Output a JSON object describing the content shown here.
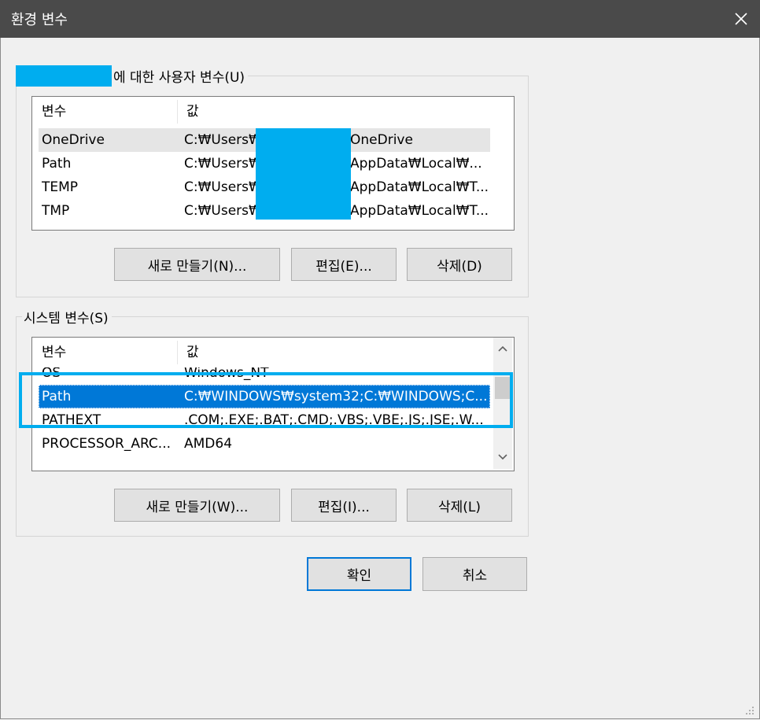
{
  "window": {
    "title": "환경 변수",
    "close_icon": "close-icon"
  },
  "user_vars": {
    "legend": "에 대한 사용자 변수(U)",
    "columns": [
      "변수",
      "값"
    ],
    "rows": [
      {
        "name": "OneDrive",
        "value_prefix": "C:₩Users₩",
        "value_suffix": "OneDrive"
      },
      {
        "name": "Path",
        "value_prefix": "C:₩Users₩",
        "value_suffix": "AppData₩Local₩..."
      },
      {
        "name": "TEMP",
        "value_prefix": "C:₩Users₩",
        "value_suffix": "AppData₩Local₩T..."
      },
      {
        "name": "TMP",
        "value_prefix": "C:₩Users₩",
        "value_suffix": "AppData₩Local₩T..."
      }
    ],
    "buttons": {
      "new": "새로 만들기(N)...",
      "edit": "편집(E)...",
      "delete": "삭제(D)"
    }
  },
  "system_vars": {
    "legend": "시스템 변수(S)",
    "columns": [
      "변수",
      "값"
    ],
    "rows": [
      {
        "name": "OS",
        "value": "Windows_NT"
      },
      {
        "name": "Path",
        "value": "C:₩WINDOWS₩system32;C:₩WINDOWS;C..."
      },
      {
        "name": "PATHEXT",
        "value": ".COM;.EXE;.BAT;.CMD;.VBS;.VBE;.JS;.JSE;.W..."
      },
      {
        "name": "PROCESSOR_ARC...",
        "value": "AMD64"
      }
    ],
    "selected_row": "Path",
    "buttons": {
      "new": "새로 만들기(W)...",
      "edit": "편집(I)...",
      "delete": "삭제(L)"
    }
  },
  "footer": {
    "ok": "확인",
    "cancel": "취소"
  },
  "colors": {
    "redaction": "#00adef",
    "selection": "#0078d7",
    "highlight_outline": "#00adef"
  }
}
